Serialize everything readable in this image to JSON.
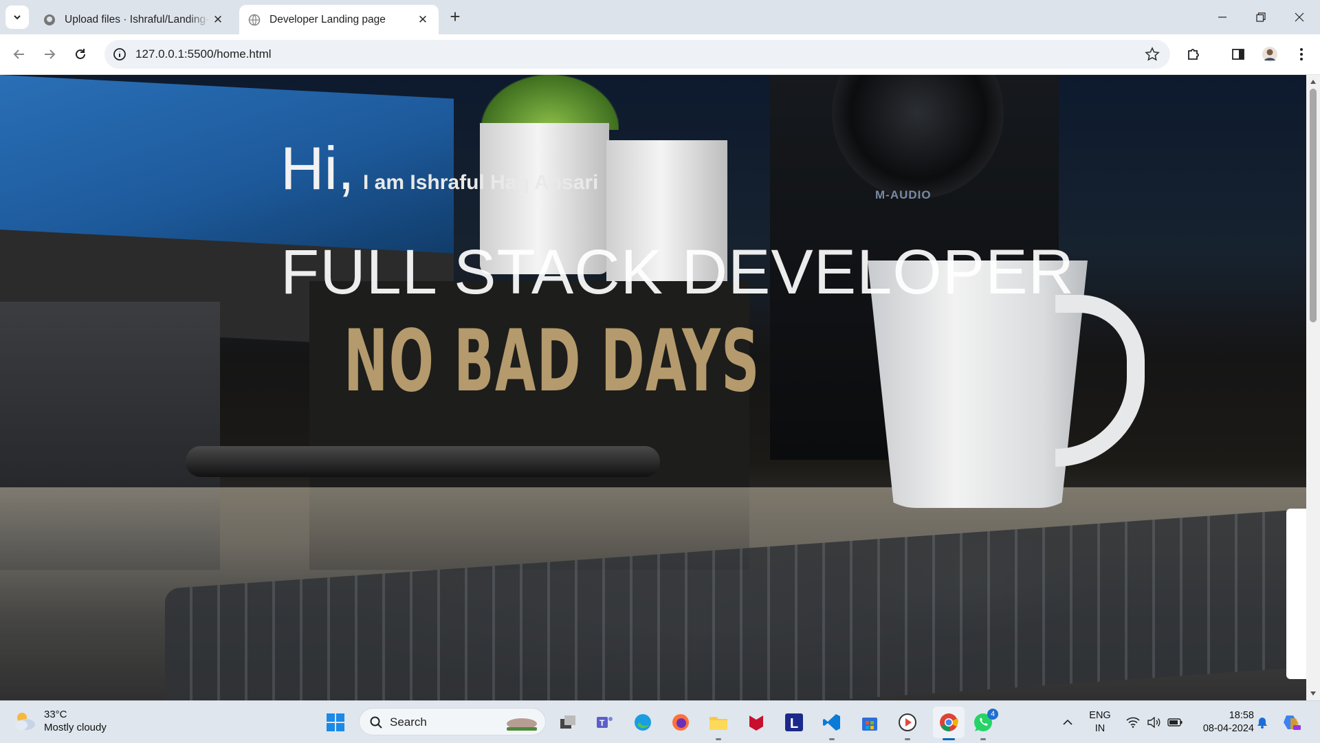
{
  "browser": {
    "tabs": [
      {
        "title": "Upload files · Ishraful/Landing-Page",
        "favicon": "github-icon",
        "active": false
      },
      {
        "title": "Developer Landing page",
        "favicon": "globe-icon",
        "active": true
      }
    ],
    "new_tab": "+",
    "address": "127.0.0.1:5500/home.html"
  },
  "page": {
    "greeting": "Hi,",
    "intro": "I am Ishraful Haq Ansari",
    "role": "FULL STACK DEVELOPER",
    "photo_sign_text": "NO BAD DAYS",
    "photo_brand_text": "M-AUDIO"
  },
  "taskbar": {
    "weather": {
      "temp": "33°C",
      "condition": "Mostly cloudy"
    },
    "search_placeholder": "Search",
    "apps": [
      "start-icon",
      "search",
      "task-view-icon",
      "teams-icon",
      "edge-icon",
      "firefox-icon",
      "file-explorer-icon",
      "mcafee-icon",
      "l-app-icon",
      "vscode-icon",
      "store-icon",
      "media-player-icon",
      "chrome-icon",
      "whatsapp-icon"
    ],
    "whatsapp_badge": "4",
    "language": {
      "line1": "ENG",
      "line2": "IN"
    },
    "time": "18:58",
    "date": "08-04-2024"
  },
  "colors": {
    "accent": "#0067c0",
    "tabstrip": "#dde3ea",
    "omnibox": "#eef1f5"
  }
}
